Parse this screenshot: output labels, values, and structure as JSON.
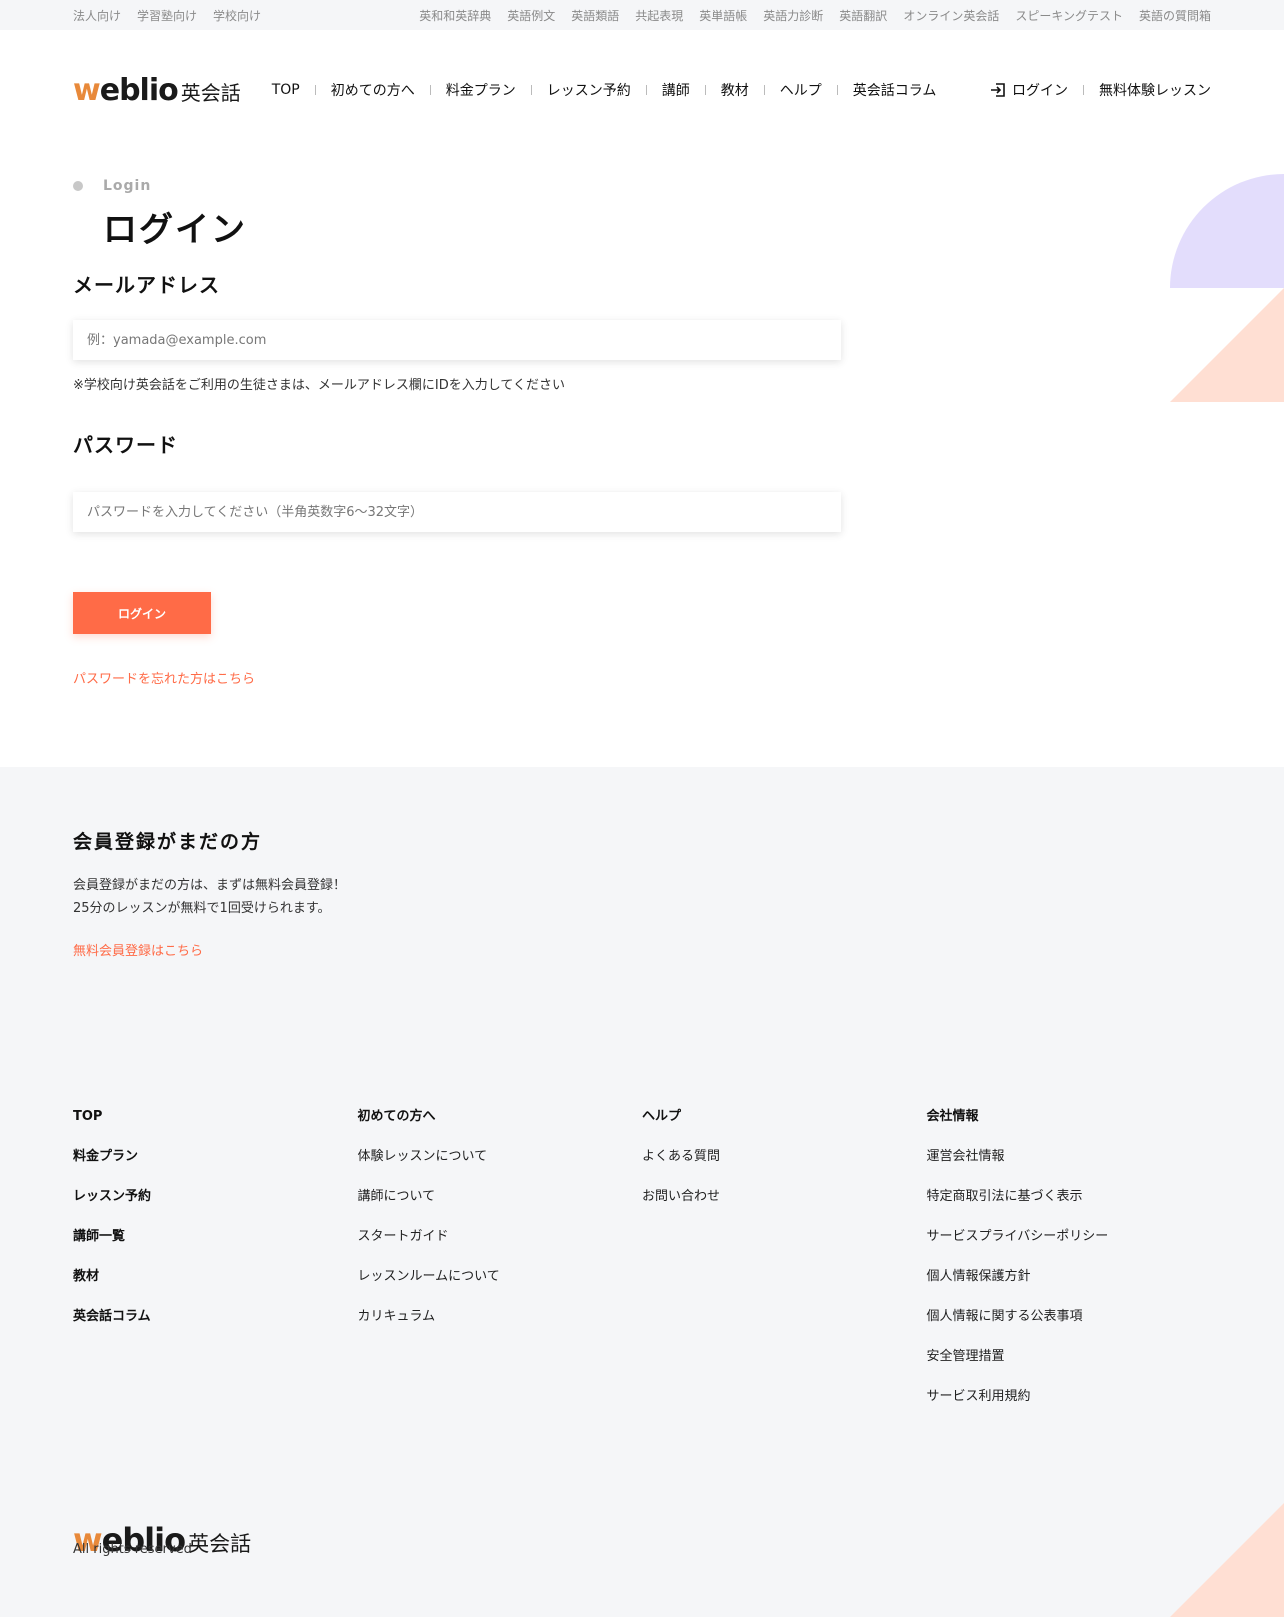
{
  "utility": {
    "left": [
      "法人向け",
      "学習塾向け",
      "学校向け"
    ],
    "right": [
      "英和和英辞典",
      "英語例文",
      "英語類語",
      "共起表現",
      "英単語帳",
      "英語力診断",
      "英語翻訳",
      "オンライン英会話",
      "スピーキングテスト",
      "英語の質問箱"
    ]
  },
  "logo": {
    "w": "w",
    "rest": "eblio",
    "jp": "英会話"
  },
  "nav": [
    "TOP",
    "初めての方へ",
    "料金プラン",
    "レッスン予約",
    "講師",
    "教材",
    "ヘルプ",
    "英会話コラム"
  ],
  "nav_right": {
    "login": "ログイン",
    "trial": "無料体験レッスン"
  },
  "main": {
    "eyebrow": "Login",
    "title": "ログイン",
    "email_label": "メールアドレス",
    "email_placeholder": "例：yamada@example.com",
    "email_note": "※学校向け英会話をご利用の生徒さまは、メールアドレス欄にIDを入力してください",
    "password_label": "パスワード",
    "password_placeholder": "パスワードを入力してください（半角英数字6〜32文字）",
    "login_button": "ログイン",
    "forgot_link": "パスワードを忘れた方はこちら"
  },
  "register": {
    "title": "会員登録がまだの方",
    "line1": "会員登録がまだの方は、まずは無料会員登録！",
    "line2": "25分のレッスンが無料で1回受けられます。",
    "link": "無料会員登録はこちら"
  },
  "footer": {
    "col1": [
      "TOP",
      "料金プラン",
      "レッスン予約",
      "講師一覧",
      "教材",
      "英会話コラム"
    ],
    "col2": [
      "初めての方へ",
      "体験レッスンについて",
      "講師について",
      "スタートガイド",
      "レッスンルームについて",
      "カリキュラム"
    ],
    "col3": [
      "ヘルプ",
      "よくある質問",
      "お問い合わせ"
    ],
    "col4": [
      "会社情報",
      "運営会社情報",
      "特定商取引法に基づく表示",
      "サービスプライバシーポリシー",
      "個人情報保護方針",
      "個人情報に関する公表事項",
      "安全管理措置",
      "サービス利用規約"
    ],
    "copyright": "All rights reserved"
  },
  "colors": {
    "accent": "#ff6b47",
    "logo_w": "#e8893a",
    "lavender": "#e3ddfc",
    "peach": "#ffdfd3"
  }
}
